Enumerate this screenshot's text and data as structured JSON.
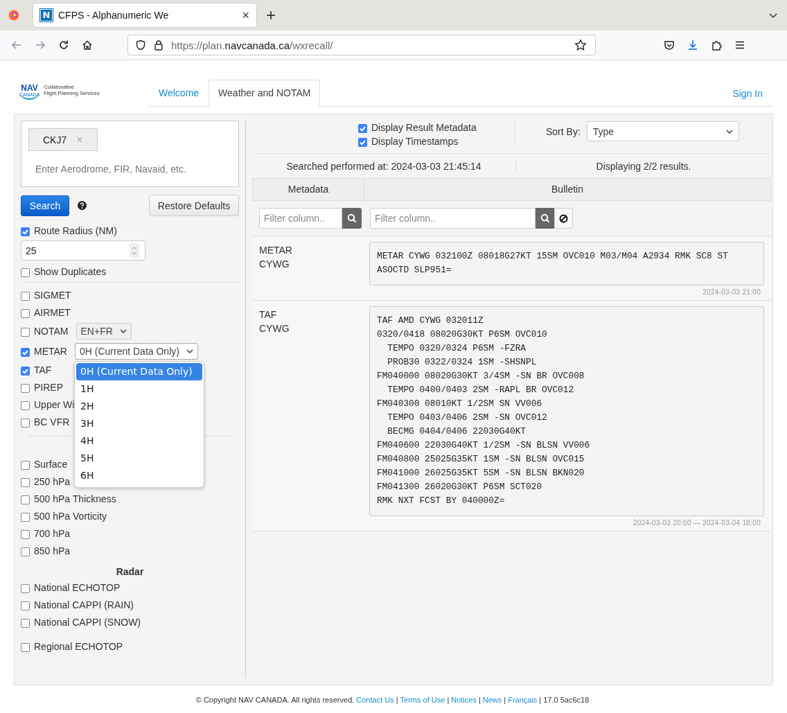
{
  "browser": {
    "favicon": "N",
    "tab_title": "CFPS - Alphanumeric We",
    "tab_close": "×",
    "new_tab": "+",
    "url_scheme": "https://plan.",
    "url_domain": "navcanada.ca",
    "url_path": "/wxrecall/"
  },
  "header": {
    "logo": {
      "mark": "NAV",
      "sub": "CANADA",
      "line1": "Collaborative",
      "line2": "Flight Planning Services"
    },
    "tabs": [
      {
        "label": "Welcome",
        "selected": false
      },
      {
        "label": "Weather and NOTAM",
        "selected": true
      }
    ],
    "sign_in": "Sign In"
  },
  "search": {
    "chips": [
      {
        "label": "CKJ7",
        "remove": "×"
      }
    ],
    "placeholder": "Enter Aerodrome, FIR, Navaid, etc.",
    "search_button": "Search",
    "restore_button": "Restore Defaults"
  },
  "route_radius": {
    "label": "Route Radius (NM)",
    "checked": true,
    "value": "25"
  },
  "show_duplicates": {
    "label": "Show Duplicates",
    "checked": false
  },
  "products": [
    {
      "kind": "check",
      "label": "SIGMET",
      "checked": false
    },
    {
      "kind": "check",
      "label": "AIRMET",
      "checked": false
    },
    {
      "kind": "select",
      "label": "NOTAM",
      "checked": false,
      "value": "EN+FR",
      "expanded": false
    },
    {
      "kind": "select",
      "label": "METAR",
      "checked": true,
      "value": "0H (Current Data Only)",
      "expanded": true,
      "options": [
        {
          "label": "0H (Current Data Only)",
          "selected": true
        },
        {
          "label": "1H",
          "selected": false
        },
        {
          "label": "2H",
          "selected": false
        },
        {
          "label": "3H",
          "selected": false
        },
        {
          "label": "4H",
          "selected": false
        },
        {
          "label": "5H",
          "selected": false
        },
        {
          "label": "6H",
          "selected": false
        }
      ]
    },
    {
      "kind": "check",
      "label": "TAF",
      "checked": true
    },
    {
      "kind": "check",
      "label": "PIREP",
      "checked": false
    },
    {
      "kind": "check",
      "label": "Upper Wi",
      "checked": false
    },
    {
      "kind": "check",
      "label": "BC VFR",
      "checked": false
    }
  ],
  "charts": [
    {
      "label": "Surface",
      "checked": false
    },
    {
      "label": "250 hPa",
      "checked": false
    },
    {
      "label": "500 hPa Thickness",
      "checked": false
    },
    {
      "label": "500 hPa Vorticity",
      "checked": false
    },
    {
      "label": "700 hPa",
      "checked": false
    },
    {
      "label": "850 hPa",
      "checked": false
    }
  ],
  "radar_heading": "Radar",
  "radar": [
    {
      "label": "National ECHOTOP",
      "checked": false
    },
    {
      "label": "National CAPPI (RAIN)",
      "checked": false
    },
    {
      "label": "National CAPPI (SNOW)",
      "checked": false
    }
  ],
  "radar_regional": [
    {
      "label": "Regional ECHOTOP",
      "checked": false
    }
  ],
  "display_options": [
    {
      "label": "Display Result Metadata",
      "checked": true
    },
    {
      "label": "Display Timestamps",
      "checked": true
    }
  ],
  "sort": {
    "label": "Sort By:",
    "value": "Type"
  },
  "search_time": "Searched performed at: 2024-03-03 21:45:14",
  "result_count": "Displaying 2/2 results.",
  "table": {
    "columns": [
      "Metadata",
      "Bulletin"
    ],
    "filter_placeholders": [
      "Filter column..",
      "Filter column.."
    ]
  },
  "results": [
    {
      "type": "METAR",
      "station": "CYWG",
      "lines": [
        "METAR CYWG 032100Z 08018G27KT 15SM OVC010 M03/M04 A2934 RMK SC8 ST",
        "ASOCTD SLP951="
      ],
      "timestamp": "2024-03-03 21:00"
    },
    {
      "type": "TAF",
      "station": "CYWG",
      "lines": [
        "TAF AMD CYWG 032011Z",
        "0320/0418 08020G30KT P6SM OVC010",
        "  TEMPO 0320/0324 P6SM -FZRA",
        "  PROB30 0322/0324 1SM -SHSNPL",
        "FM040000 08020G30KT 3/4SM -SN BR OVC008",
        "  TEMPO 0400/0403 2SM -RAPL BR OVC012",
        "FM040300 08010KT 1/2SM SN VV006",
        "  TEMPO 0403/0406 2SM -SN OVC012",
        "  BECMG 0404/0406 22030G40KT",
        "FM040600 22030G40KT 1/2SM -SN BLSN VV006",
        "FM040800 25025G35KT 1SM -SN BLSN OVC015",
        "FM041000 26025G35KT 5SM -SN BLSN BKN020",
        "FM041300 26020G30KT P6SM SCT020",
        "RMK NXT FCST BY 040000Z="
      ],
      "timestamp": "2024-03-03 20:00 — 2024-03-04 18:00"
    }
  ],
  "footer": {
    "copyright": "© Copyright NAV CANADA. All rights reserved.",
    "links": [
      "Contact Us",
      "Terms of Use",
      "Notices",
      "News",
      "Français"
    ],
    "separator": "|",
    "version": "17.0 5ac6c18"
  }
}
